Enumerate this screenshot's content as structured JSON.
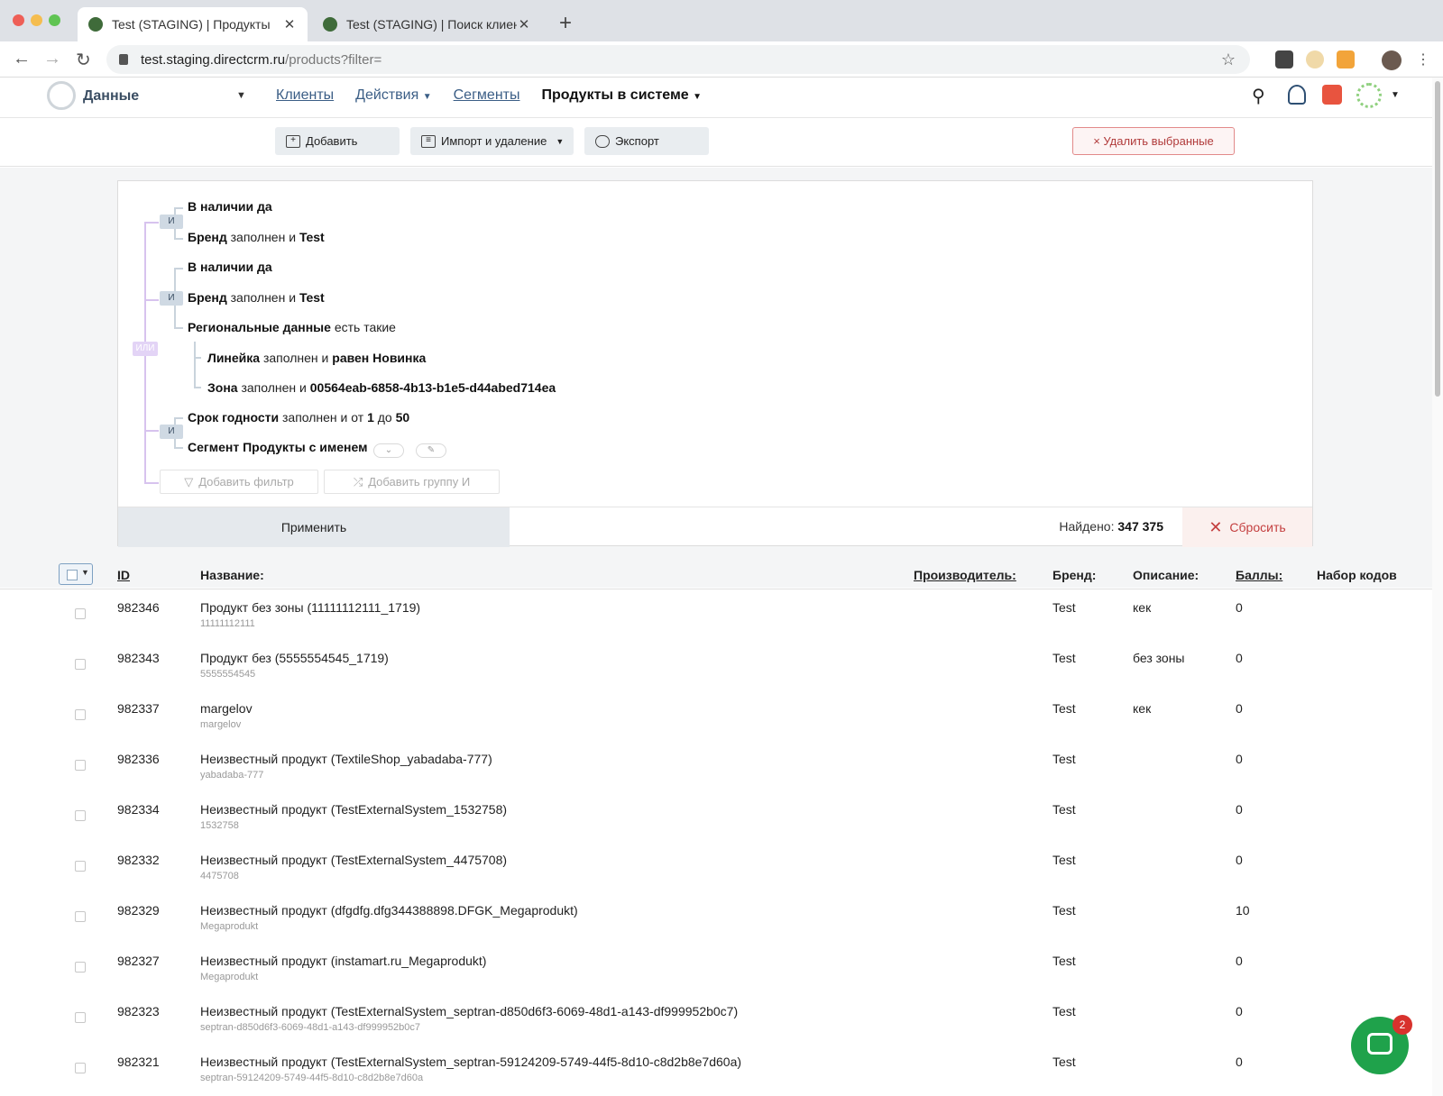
{
  "browser": {
    "tabs": [
      {
        "title": "Test (STAGING) | Продукты",
        "active": true
      },
      {
        "title": "Test (STAGING) | Поиск клиен",
        "active": false
      }
    ],
    "url_host": "test.staging.directcrm.ru",
    "url_path": "/products?filter="
  },
  "header": {
    "brand": "Данные",
    "nav": [
      {
        "label": "Клиенты"
      },
      {
        "label": "Действия"
      },
      {
        "label": "Сегменты"
      },
      {
        "label": "Продукты в системе"
      }
    ]
  },
  "toolbar": {
    "add": "Добавить",
    "import": "Импорт и удаление",
    "export": "Экспорт",
    "delete_selected": "× Удалить выбранные"
  },
  "filter": {
    "and_tag": "И",
    "or_tag": "ИЛИ",
    "g1_l1_field": "В наличии",
    "g1_l1_val": "да",
    "g1_l2_field": "Бренд",
    "g1_l2_op": "заполнен и",
    "g1_l2_val": "Test",
    "g2_l1_field": "В наличии",
    "g2_l1_val": "да",
    "g2_l2_field": "Бренд",
    "g2_l2_op": "заполнен и",
    "g2_l2_val": "Test",
    "g2_l3_field": "Региональные данные",
    "g2_l3_op": "есть такие",
    "g2_l4_field": "Линейка",
    "g2_l4_op": "заполнен и",
    "g2_l4_val": "равен Новинка",
    "g2_l5_field": "Зона",
    "g2_l5_op": "заполнен и",
    "g2_l5_val": "00564eab-6858-4b13-b1e5-d44abed714ea",
    "g3_l1_field": "Срок годности",
    "g3_l1_op": "заполнен и от",
    "g3_l1_from": "1",
    "g3_l1_mid": "до",
    "g3_l1_to": "50",
    "g3_l2_field": "Сегмент",
    "g3_l2_val": "Продукты с именем",
    "add_filter": "Добавить фильтр",
    "add_group": "Добавить группу И",
    "apply": "Применить",
    "found_label": "Найдено:",
    "found_count": "347 375",
    "reset": "Сбросить"
  },
  "table": {
    "headers": {
      "id": "ID",
      "name": "Название:",
      "manufacturer": "Производитель:",
      "brand": "Бренд:",
      "description": "Описание:",
      "score": "Баллы:",
      "codes": "Набор кодов"
    },
    "rows": [
      {
        "id": "982346",
        "name": "Продукт без зоны (11111112111_1719)",
        "sub": "11111112111",
        "brand": "Test",
        "desc": "кек",
        "score": "0"
      },
      {
        "id": "982343",
        "name": "Продукт без (5555554545_1719)",
        "sub": "5555554545",
        "brand": "Test",
        "desc": "без зоны",
        "score": "0"
      },
      {
        "id": "982337",
        "name": "margelov",
        "sub": "margelov",
        "brand": "Test",
        "desc": "кек",
        "score": "0"
      },
      {
        "id": "982336",
        "name": "Неизвестный продукт (TextileShop_yabadaba-777)",
        "sub": "yabadaba-777",
        "brand": "Test",
        "desc": "",
        "score": "0"
      },
      {
        "id": "982334",
        "name": "Неизвестный продукт (TestExternalSystem_1532758)",
        "sub": "1532758",
        "brand": "Test",
        "desc": "",
        "score": "0"
      },
      {
        "id": "982332",
        "name": "Неизвестный продукт (TestExternalSystem_4475708)",
        "sub": "4475708",
        "brand": "Test",
        "desc": "",
        "score": "0"
      },
      {
        "id": "982329",
        "name": "Неизвестный продукт (dfgdfg.dfg344388898.DFGK_Megaprodukt)",
        "sub": "Megaprodukt",
        "brand": "Test",
        "desc": "",
        "score": "10"
      },
      {
        "id": "982327",
        "name": "Неизвестный продукт (instamart.ru_Megaprodukt)",
        "sub": "Megaprodukt",
        "brand": "Test",
        "desc": "",
        "score": "0"
      },
      {
        "id": "982323",
        "name": "Неизвестный продукт (TestExternalSystem_septran-d850d6f3-6069-48d1-a143-df999952b0c7)",
        "sub": "septran-d850d6f3-6069-48d1-a143-df999952b0c7",
        "brand": "Test",
        "desc": "",
        "score": "0"
      },
      {
        "id": "982321",
        "name": "Неизвестный продукт (TestExternalSystem_septran-59124209-5749-44f5-8d10-c8d2b8e7d60a)",
        "sub": "septran-59124209-5749-44f5-8d10-c8d2b8e7d60a",
        "brand": "Test",
        "desc": "",
        "score": "0"
      }
    ]
  },
  "chat": {
    "badge": "2"
  }
}
